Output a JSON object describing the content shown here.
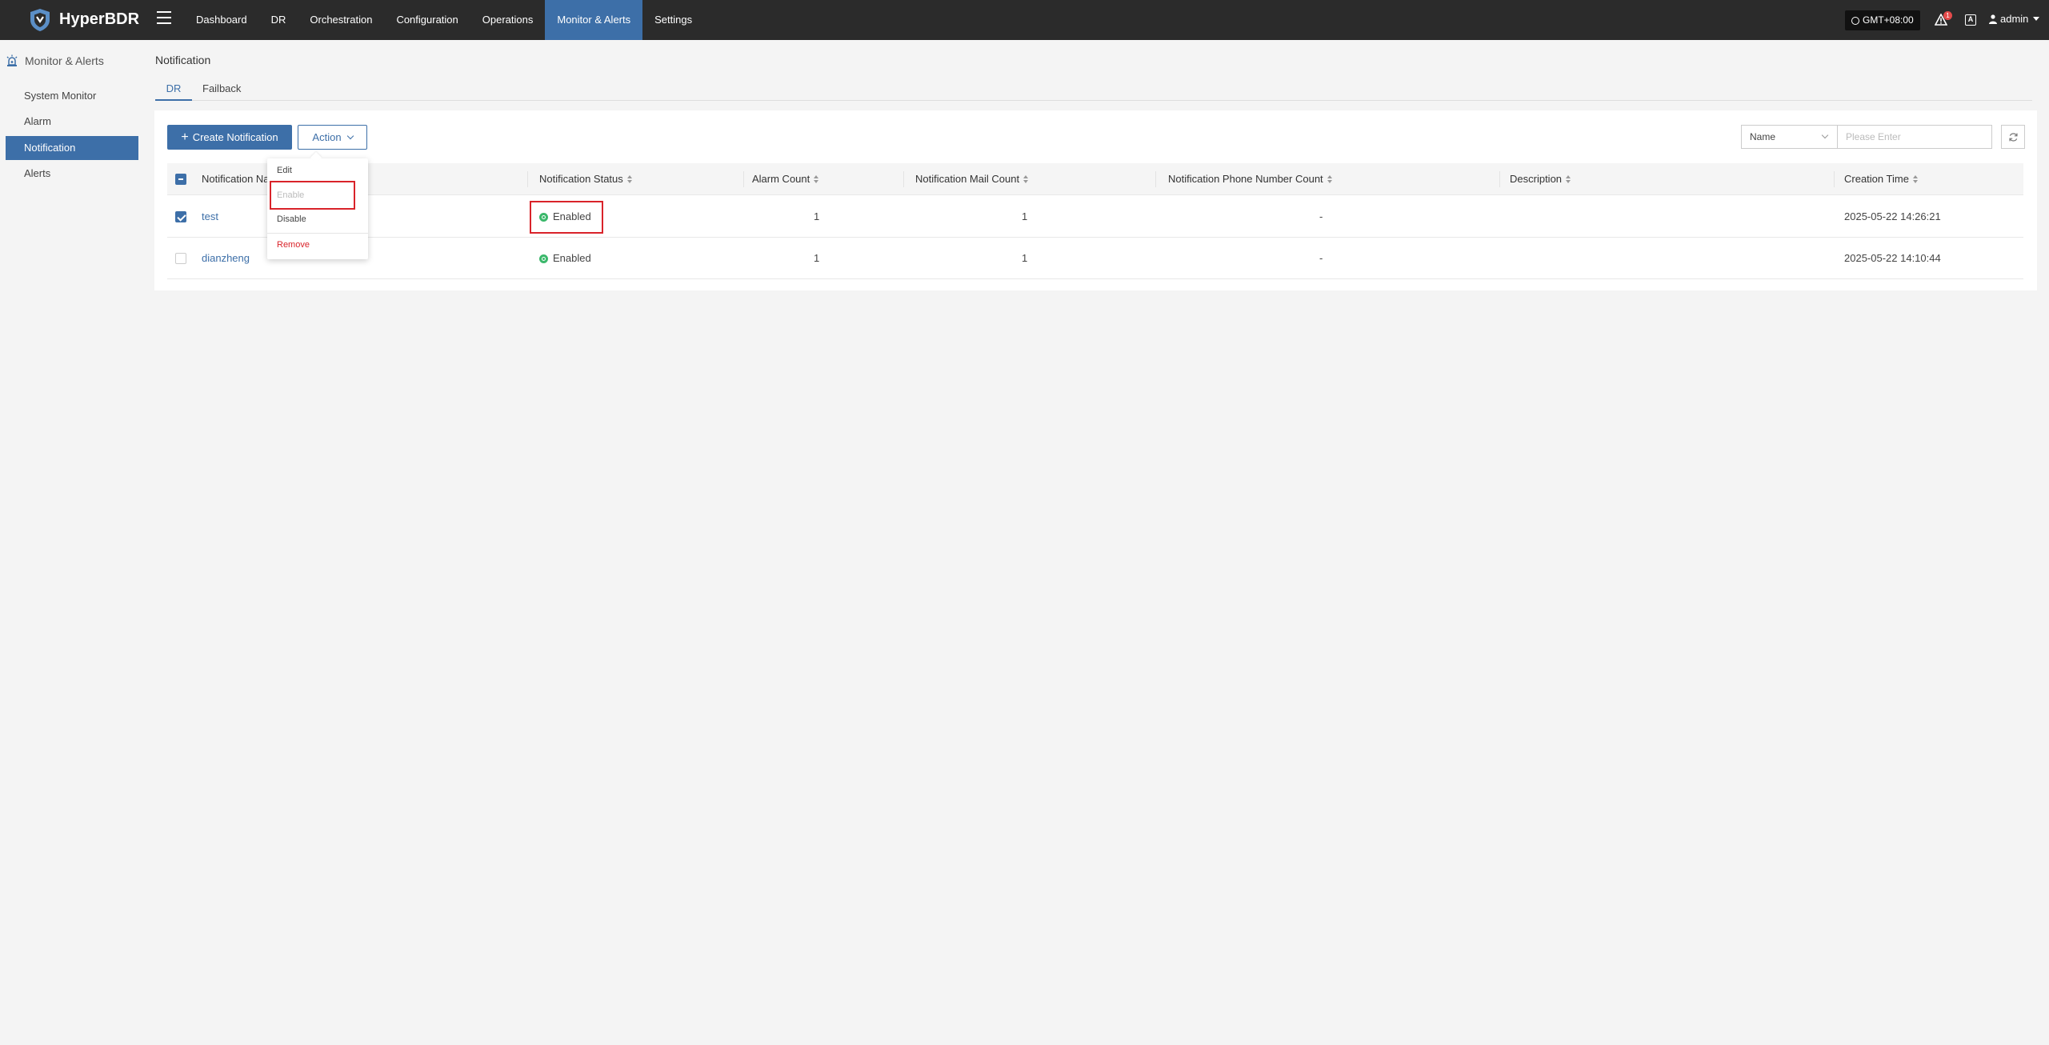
{
  "app": {
    "brand": "HyperBDR"
  },
  "nav": {
    "items": [
      {
        "label": "Dashboard",
        "active": false
      },
      {
        "label": "DR",
        "active": false
      },
      {
        "label": "Orchestration",
        "active": false
      },
      {
        "label": "Configuration",
        "active": false
      },
      {
        "label": "Operations",
        "active": false
      },
      {
        "label": "Monitor & Alerts",
        "active": true
      },
      {
        "label": "Settings",
        "active": false
      }
    ]
  },
  "header": {
    "timezone": "GMT+08:00",
    "alert_badge": "1",
    "user": "admin"
  },
  "sidebar": {
    "section": "Monitor & Alerts",
    "items": [
      {
        "label": "System Monitor",
        "active": false
      },
      {
        "label": "Alarm",
        "active": false
      },
      {
        "label": "Notification",
        "active": true
      },
      {
        "label": "Alerts",
        "active": false
      }
    ]
  },
  "page": {
    "title": "Notification",
    "tabs": [
      {
        "label": "DR",
        "active": true
      },
      {
        "label": "Failback",
        "active": false
      }
    ]
  },
  "toolbar": {
    "create_label": "Create Notification",
    "action_label": "Action",
    "filter_field": "Name",
    "search_placeholder": "Please Enter"
  },
  "action_menu": {
    "items": [
      {
        "label": "Edit",
        "state": "normal"
      },
      {
        "label": "Enable",
        "state": "disabled"
      },
      {
        "label": "Disable",
        "state": "normal"
      },
      {
        "label": "Remove",
        "state": "danger"
      }
    ]
  },
  "table": {
    "columns": [
      "Notification Name",
      "Notification Status",
      "Alarm Count",
      "Notification Mail Count",
      "Notification Phone Number Count",
      "Description",
      "Creation Time"
    ],
    "rows": [
      {
        "selected": true,
        "name": "test",
        "status": "Enabled",
        "alarm_count": "1",
        "mail_count": "1",
        "phone_count": "-",
        "description": "",
        "created": "2025-05-22 14:26:21"
      },
      {
        "selected": false,
        "name": "dianzheng",
        "status": "Enabled",
        "alarm_count": "1",
        "mail_count": "1",
        "phone_count": "-",
        "description": "",
        "created": "2025-05-22 14:10:44"
      }
    ]
  },
  "colors": {
    "topbar": "#2b2b2b",
    "accent": "#3d6fa8",
    "status_enabled": "#3bb86b",
    "highlight": "#d9232a"
  }
}
